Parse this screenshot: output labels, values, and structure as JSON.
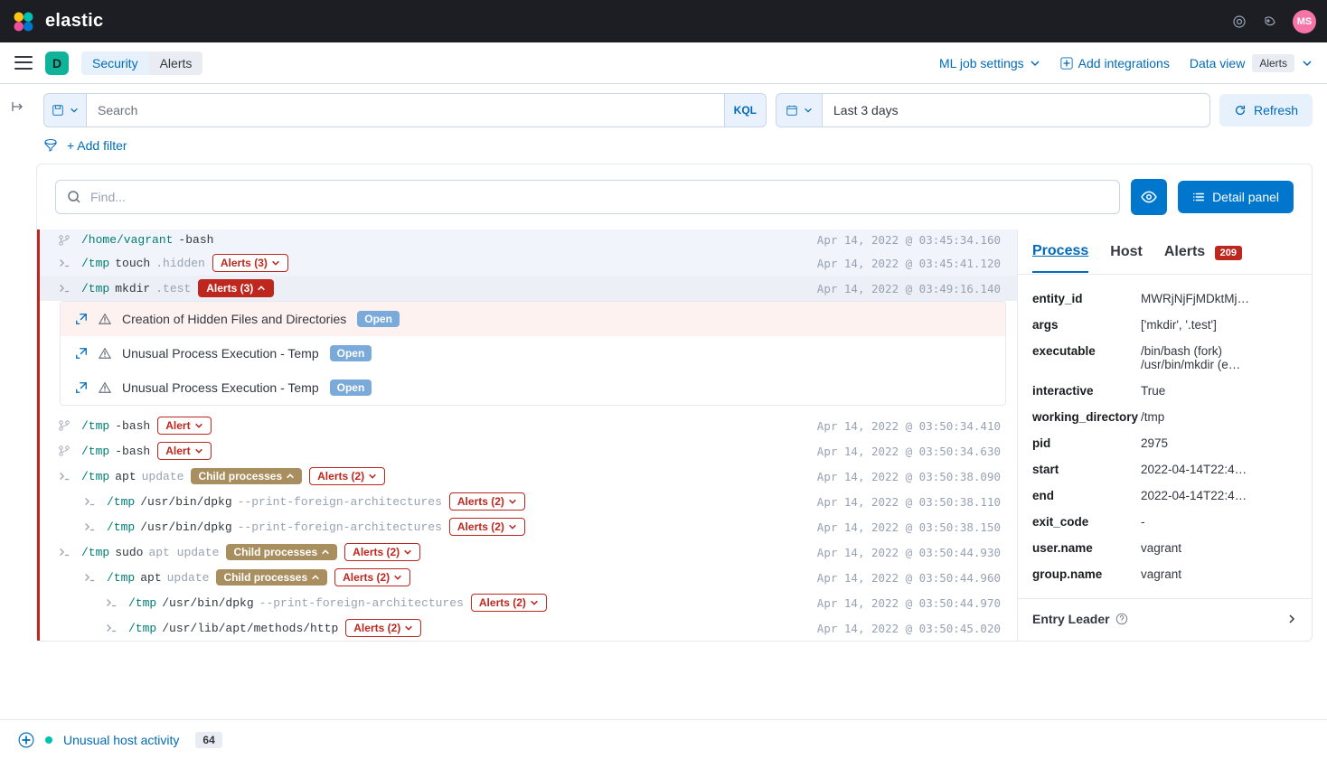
{
  "topbar": {
    "brand": "elastic",
    "avatar": "MS"
  },
  "breadcrumb": {
    "section": "Security",
    "page": "Alerts"
  },
  "subhdr": {
    "ml": "ML job settings",
    "add_int": "Add integrations",
    "dataview": "Data view",
    "dv_badge": "Alerts"
  },
  "filter": {
    "search_ph": "Search",
    "kql": "KQL",
    "date": "Last 3 days",
    "refresh": "Refresh",
    "addfilter": "+ Add filter"
  },
  "panel": {
    "find_ph": "Find...",
    "detail": "Detail panel"
  },
  "rows": [
    {
      "id": "r0",
      "icon": "branch",
      "indent": 0,
      "path": "/home/vagrant",
      "cmd": "-bash",
      "args": "",
      "tags": [],
      "ts": "Apr 14, 2022 @ 03:45:34.160",
      "sel": true
    },
    {
      "id": "r1",
      "icon": "prompt",
      "indent": 0,
      "path": "/tmp",
      "cmd": "touch",
      "args": ".hidden",
      "tags": [
        {
          "t": "Alerts (3)",
          "k": "alert-out",
          "chev": "down"
        }
      ],
      "ts": "Apr 14, 2022 @ 03:45:41.120",
      "sel": true
    },
    {
      "id": "r2",
      "icon": "prompt",
      "indent": 0,
      "path": "/tmp",
      "cmd": "mkdir",
      "args": ".test",
      "tags": [
        {
          "t": "Alerts (3)",
          "k": "alert-fill",
          "chev": "up"
        }
      ],
      "ts": "Apr 14, 2022 @ 03:49:16.140",
      "sel": "active"
    }
  ],
  "alerts_exp": [
    {
      "label": "Creation of Hidden Files and Directories",
      "status": "Open",
      "hl": true
    },
    {
      "label": "Unusual Process Execution - Temp",
      "status": "Open"
    },
    {
      "label": "Unusual Process Execution - Temp",
      "status": "Open"
    }
  ],
  "rows2": [
    {
      "icon": "branch",
      "indent": 0,
      "path": "/tmp",
      "cmd": "-bash",
      "args": "",
      "tags": [
        {
          "t": "Alert",
          "k": "alert-out",
          "chev": "down"
        }
      ],
      "ts": "Apr 14, 2022 @ 03:50:34.410"
    },
    {
      "icon": "branch",
      "indent": 0,
      "path": "/tmp",
      "cmd": "-bash",
      "args": "",
      "tags": [
        {
          "t": "Alert",
          "k": "alert-out",
          "chev": "down"
        }
      ],
      "ts": "Apr 14, 2022 @ 03:50:34.630"
    },
    {
      "icon": "prompt",
      "indent": 0,
      "path": "/tmp",
      "cmd": "apt",
      "args": "update",
      "tags": [
        {
          "t": "Child processes",
          "k": "child",
          "chev": "up"
        },
        {
          "t": "Alerts (2)",
          "k": "alert-out",
          "chev": "down"
        }
      ],
      "ts": "Apr 14, 2022 @ 03:50:38.090"
    },
    {
      "icon": "prompt",
      "indent": 1,
      "path": "/tmp",
      "cmd": "/usr/bin/dpkg",
      "args": "--print-foreign-architectures",
      "tags": [
        {
          "t": "Alerts (2)",
          "k": "alert-out",
          "chev": "down"
        }
      ],
      "ts": "Apr 14, 2022 @ 03:50:38.110"
    },
    {
      "icon": "prompt",
      "indent": 1,
      "path": "/tmp",
      "cmd": "/usr/bin/dpkg",
      "args": "--print-foreign-architectures",
      "tags": [
        {
          "t": "Alerts (2)",
          "k": "alert-out",
          "chev": "down"
        }
      ],
      "ts": "Apr 14, 2022 @ 03:50:38.150"
    },
    {
      "icon": "prompt",
      "indent": 0,
      "path": "/tmp",
      "cmd": "sudo",
      "args2": "apt update",
      "tags": [
        {
          "t": "Child processes",
          "k": "child",
          "chev": "up"
        },
        {
          "t": "Alerts (2)",
          "k": "alert-out",
          "chev": "down"
        }
      ],
      "ts": "Apr 14, 2022 @ 03:50:44.930"
    },
    {
      "icon": "prompt",
      "indent": 1,
      "path": "/tmp",
      "cmd": "apt",
      "args": "update",
      "tags": [
        {
          "t": "Child processes",
          "k": "child",
          "chev": "up"
        },
        {
          "t": "Alerts (2)",
          "k": "alert-out",
          "chev": "down"
        }
      ],
      "ts": "Apr 14, 2022 @ 03:50:44.960"
    },
    {
      "icon": "prompt",
      "indent": 2,
      "path": "/tmp",
      "cmd": "/usr/bin/dpkg",
      "args": "--print-foreign-architectures",
      "tags": [
        {
          "t": "Alerts (2)",
          "k": "alert-out",
          "chev": "down"
        }
      ],
      "ts": "Apr 14, 2022 @ 03:50:44.970"
    },
    {
      "icon": "prompt",
      "indent": 2,
      "path": "/tmp",
      "cmd": "/usr/lib/apt/methods/http",
      "args": "",
      "tags": [
        {
          "t": "Alerts (2)",
          "k": "alert-out",
          "chev": "down"
        }
      ],
      "ts": "Apr 14, 2022 @ 03:50:45.020"
    }
  ],
  "side": {
    "tabs": {
      "process": "Process",
      "host": "Host",
      "alerts": "Alerts",
      "alerts_count": "209"
    },
    "fields": [
      {
        "k": "entity_id",
        "v": "MWRjNjFjMDktMj…"
      },
      {
        "k": "args",
        "v": "['mkdir', '.test']"
      },
      {
        "k": "executable",
        "v": "/bin/bash (fork)\n/usr/bin/mkdir (e…"
      },
      {
        "k": "interactive",
        "v": "True"
      },
      {
        "k": "working_directory",
        "v": "/tmp"
      },
      {
        "k": "pid",
        "v": "2975"
      },
      {
        "k": "start",
        "v": "2022-04-14T22:4…"
      },
      {
        "k": "end",
        "v": "2022-04-14T22:4…"
      },
      {
        "k": "exit_code",
        "v": "-"
      },
      {
        "k": "user.name",
        "v": "vagrant"
      },
      {
        "k": "group.name",
        "v": "vagrant"
      }
    ],
    "entry": "Entry Leader"
  },
  "timeline": {
    "label": "Unusual host activity",
    "count": "64"
  }
}
